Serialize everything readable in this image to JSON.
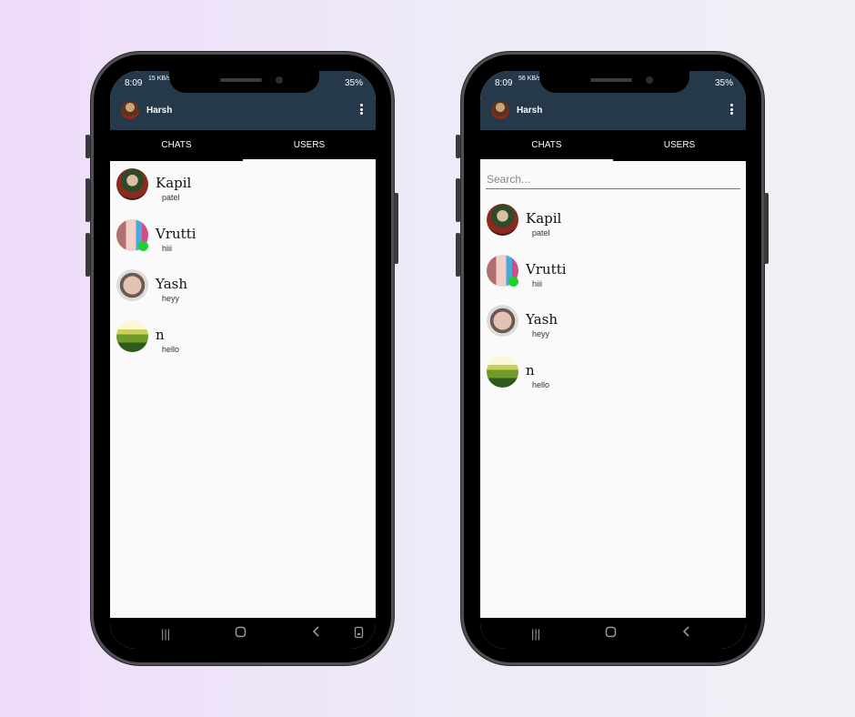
{
  "screens": [
    {
      "status": {
        "time": "8:09",
        "icons": "15\nKB/s",
        "right": "35%"
      },
      "appbar": {
        "user": "Harsh"
      },
      "tabs": [
        {
          "label": "CHATS",
          "active": true
        },
        {
          "label": "USERS",
          "active": false
        }
      ],
      "search_placeholder": "",
      "list": [
        {
          "name": "Kapil",
          "message": "patel",
          "online": false,
          "avatar": "avatar-kapil"
        },
        {
          "name": "Vrutti",
          "message": "hiii",
          "online": true,
          "avatar": "avatar-vrutti"
        },
        {
          "name": "Yash",
          "message": "heyy",
          "online": false,
          "avatar": "avatar-yash"
        },
        {
          "name": "n",
          "message": "hello",
          "online": false,
          "avatar": "avatar-landscape"
        }
      ]
    },
    {
      "status": {
        "time": "8:09",
        "icons": "56\nKB/s",
        "right": "35%"
      },
      "appbar": {
        "user": "Harsh"
      },
      "tabs": [
        {
          "label": "CHATS",
          "active": false
        },
        {
          "label": "USERS",
          "active": true
        }
      ],
      "search_placeholder": "Search...",
      "list": [
        {
          "name": "Kapil",
          "message": "patel",
          "online": false,
          "avatar": "avatar-kapil"
        },
        {
          "name": "Vrutti",
          "message": "hiii",
          "online": true,
          "avatar": "avatar-vrutti"
        },
        {
          "name": "Yash",
          "message": "heyy",
          "online": false,
          "avatar": "avatar-yash"
        },
        {
          "name": "n",
          "message": "hello",
          "online": false,
          "avatar": "avatar-landscape"
        }
      ]
    }
  ],
  "icons": {
    "menu": "more-vert-icon",
    "nav": [
      "recent-apps-icon",
      "home-icon",
      "back-icon",
      "rotate-icon"
    ]
  }
}
